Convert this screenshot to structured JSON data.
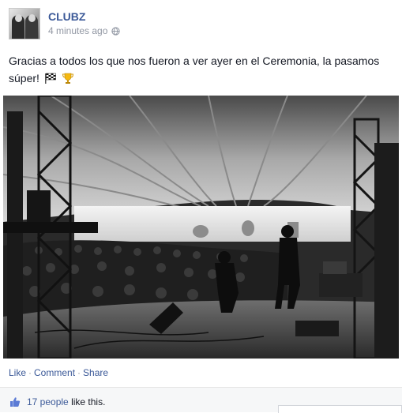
{
  "post": {
    "page_name": "CLUBZ",
    "timestamp": "4 minutes ago",
    "privacy_icon": "globe-icon",
    "text": "Gracias a todos los que nos fueron a ver ayer en el Ceremonia, la pasamos súper!",
    "emojis": [
      "checkered-flag-icon",
      "trophy-icon"
    ]
  },
  "photo": {
    "icon": "concert-stage-photo"
  },
  "actions": {
    "like": "Like",
    "comment": "Comment",
    "share": "Share",
    "separator": "·"
  },
  "likes": {
    "count_text": "17 people",
    "suffix": "like this.",
    "icon": "thumbs-up-icon"
  },
  "colors": {
    "link": "#3b5998",
    "meta": "#9197a3",
    "text": "#141823",
    "likes_bg": "#f6f7f8"
  }
}
